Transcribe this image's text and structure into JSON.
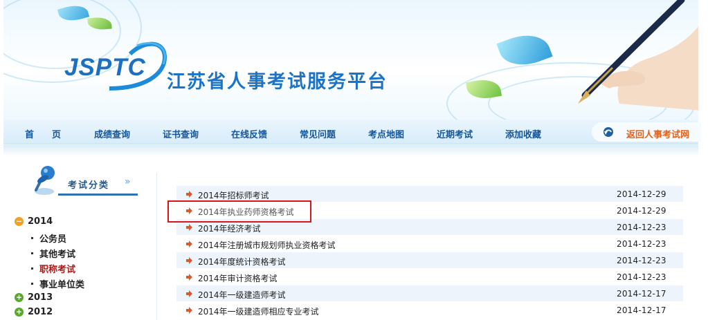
{
  "header": {
    "logo_text": "JSPTC",
    "site_title": "江苏省人事考试服务平台"
  },
  "nav": {
    "items": [
      {
        "label": "首　　页"
      },
      {
        "label": "成绩查询"
      },
      {
        "label": "证书查询"
      },
      {
        "label": "在线反馈"
      },
      {
        "label": "常见问题"
      },
      {
        "label": "考点地图"
      },
      {
        "label": "近期考试"
      },
      {
        "label": "添加收藏"
      }
    ],
    "back_label": "返回人事考试网"
  },
  "sidebar": {
    "title": "考试分类",
    "arrows": "»",
    "years": [
      {
        "label": "2014",
        "expanded": true,
        "children": [
          {
            "label": "公务员",
            "active": false
          },
          {
            "label": "其他考试",
            "active": false
          },
          {
            "label": "职称考试",
            "active": true
          },
          {
            "label": "事业单位类",
            "active": false
          }
        ]
      },
      {
        "label": "2013",
        "expanded": false
      },
      {
        "label": "2012",
        "expanded": false
      }
    ]
  },
  "exams": [
    {
      "title": "2014年招标师考试",
      "date": "2014-12-29"
    },
    {
      "title": "2014年执业药师资格考试",
      "date": "2014-12-29"
    },
    {
      "title": "2014年经济考试",
      "date": "2014-12-23"
    },
    {
      "title": "2014年注册城市规划师执业资格考试",
      "date": "2014-12-23"
    },
    {
      "title": "2014年度统计资格考试",
      "date": "2014-12-23"
    },
    {
      "title": "2014年审计资格考试",
      "date": "2014-12-23"
    },
    {
      "title": "2014年一级建造师考试",
      "date": "2014-12-17"
    },
    {
      "title": "2014年一级建造师相应专业考试",
      "date": "2014-12-17"
    }
  ],
  "colors": {
    "brand_blue": "#1b73c8",
    "nav_text": "#15559b",
    "back_orange": "#e2621b",
    "highlight_red": "#d8141c",
    "active_red": "#b01818"
  },
  "icons": {
    "logo": "swoosh-logo-icon",
    "back": "return-arrow-icon",
    "pin": "pushpin-icon",
    "row": "right-arrow-icon"
  }
}
